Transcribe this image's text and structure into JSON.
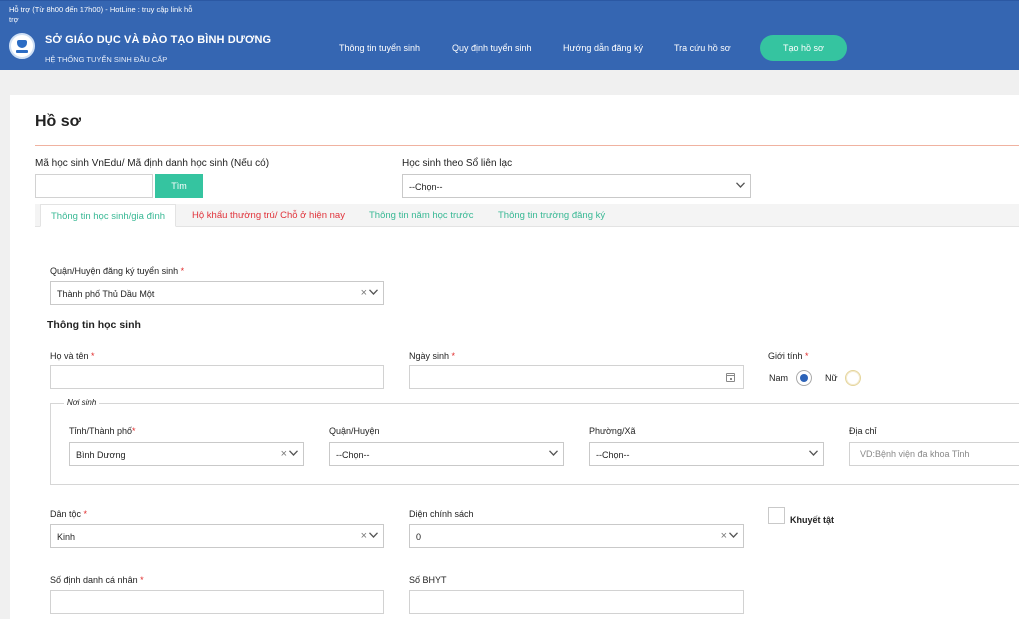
{
  "header": {
    "support_text": "Hỗ trợ (Từ 8h00 đến 17h00) - HotLine : truy cập link hỗ trợ",
    "org_name": "SỞ GIÁO DỤC VÀ ĐÀO TẠO BÌNH DƯƠNG",
    "org_sub": "HỆ THỐNG TUYỂN SINH ĐẦU CẤP",
    "nav": [
      {
        "label": "Thông tin tuyển sinh"
      },
      {
        "label": "Quy định tuyển sinh"
      },
      {
        "label": "Hướng dẫn đăng ký"
      },
      {
        "label": "Tra cứu hồ sơ"
      }
    ],
    "cta_label": "Tạo hồ sơ"
  },
  "page": {
    "title": "Hồ sơ"
  },
  "lookup": {
    "student_code_label": "Mã học sinh VnEdu/ Mã định danh học sinh (Nếu có)",
    "student_code_value": "",
    "search_button": "Tìm",
    "contact_label": "Học sinh theo Sổ liên lạc",
    "contact_value": "--Chọn--"
  },
  "tabs": [
    {
      "label": "Thông tin học sinh/gia đình",
      "active": true
    },
    {
      "label": "Hộ khẩu thường trú/ Chỗ ở hiện nay",
      "active": false
    },
    {
      "label": "Thông tin năm học trước",
      "active": false
    },
    {
      "label": "Thông tin trường đăng ký",
      "active": false
    }
  ],
  "form": {
    "district_label": "Quận/Huyện đăng ký tuyển sinh",
    "district_value": "Thành phố Thủ Dầu Một",
    "section_student": "Thông tin học sinh",
    "fullname_label": "Họ và tên",
    "fullname_value": "",
    "dob_label": "Ngày sinh",
    "dob_value": "",
    "gender_label": "Giới tính",
    "gender_options": [
      "Nam",
      "Nữ"
    ],
    "gender_selected": "Nam",
    "birthplace_legend": "Nơi sinh",
    "province_label": "Tỉnh/Thành phố",
    "province_value": "Bình Dương",
    "birth_district_label": "Quận/Huyện",
    "birth_district_value": "--Chọn--",
    "ward_label": "Phường/Xã",
    "ward_value": "--Chọn--",
    "address_label": "Địa chỉ",
    "address_placeholder": "VD:Bệnh viện đa khoa Tỉnh",
    "ethnicity_label": "Dân tộc",
    "ethnicity_value": "Kinh",
    "policy_label": "Diện chính sách",
    "policy_value": "0",
    "disability_label": "Khuyết tật",
    "disability_checked": false,
    "personal_id_label": "Số định danh cá nhân",
    "personal_id_value": "",
    "health_insurance_label": "Số BHYT",
    "health_insurance_value": ""
  },
  "colors": {
    "header_bg": "#3566b2",
    "accent": "#35c4a0",
    "required": "#e02a2a",
    "tab_alert": "#e0323a"
  }
}
